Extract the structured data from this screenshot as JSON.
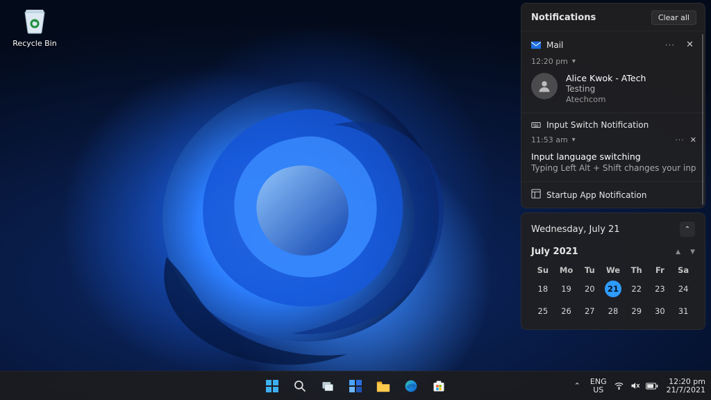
{
  "desktop": {
    "recycle_bin_label": "Recycle Bin"
  },
  "notifications": {
    "header": "Notifications",
    "clear_all": "Clear all",
    "groups": [
      {
        "app": "Mail",
        "time": "12:20 pm",
        "from": "Alice Kwok - ATech",
        "subject": "Testing",
        "domain": "Atechcom"
      },
      {
        "app": "Input Switch Notification",
        "time": "11:53 am",
        "title": "Input language switching",
        "desc": "Typing Left Alt + Shift changes your input langua"
      },
      {
        "app": "Startup App Notification"
      }
    ]
  },
  "calendar": {
    "full_date": "Wednesday, July 21",
    "month_label": "July 2021",
    "dow": [
      "Su",
      "Mo",
      "Tu",
      "We",
      "Th",
      "Fr",
      "Sa"
    ],
    "rows": [
      [
        "18",
        "19",
        "20",
        "21",
        "22",
        "23",
        "24"
      ],
      [
        "25",
        "26",
        "27",
        "28",
        "29",
        "30",
        "31"
      ]
    ],
    "today": "21"
  },
  "taskbar": {
    "lang_top": "ENG",
    "lang_bottom": "US",
    "time": "12:20 pm",
    "date": "21/7/2021"
  }
}
